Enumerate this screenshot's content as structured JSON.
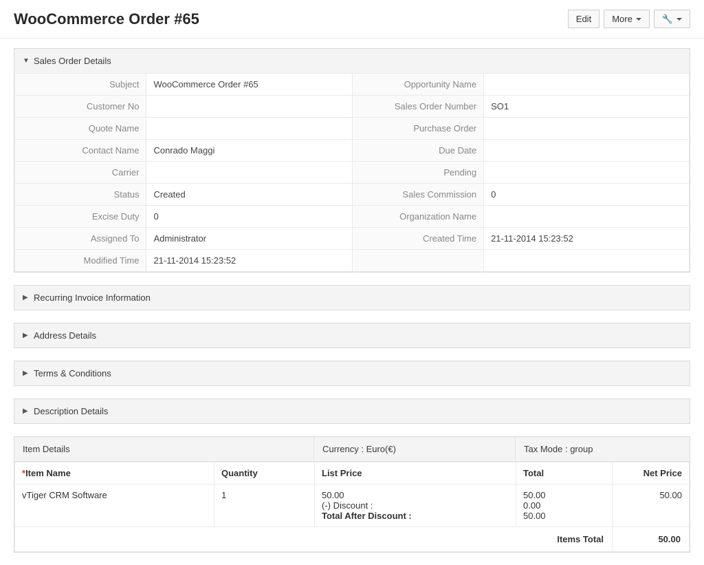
{
  "header": {
    "title": "WooCommerce Order #65",
    "buttons": {
      "edit": "Edit",
      "more": "More"
    }
  },
  "sections": {
    "sales_order_details": {
      "title": "Sales Order Details",
      "expanded": true,
      "fields": {
        "subject_label": "Subject",
        "subject_value": "WooCommerce Order #65",
        "opportunity_label": "Opportunity Name",
        "opportunity_value": "",
        "customer_no_label": "Customer No",
        "customer_no_value": "",
        "so_number_label": "Sales Order Number",
        "so_number_value": "SO1",
        "quote_name_label": "Quote Name",
        "quote_name_value": "",
        "purchase_order_label": "Purchase Order",
        "purchase_order_value": "",
        "contact_name_label": "Contact Name",
        "contact_name_value": "Conrado Maggi",
        "due_date_label": "Due Date",
        "due_date_value": "",
        "carrier_label": "Carrier",
        "carrier_value": "",
        "pending_label": "Pending",
        "pending_value": "",
        "status_label": "Status",
        "status_value": "Created",
        "sales_commission_label": "Sales Commission",
        "sales_commission_value": "0",
        "excise_duty_label": "Excise Duty",
        "excise_duty_value": "0",
        "organization_label": "Organization Name",
        "organization_value": "",
        "assigned_to_label": "Assigned To",
        "assigned_to_value": "Administrator",
        "created_time_label": "Created Time",
        "created_time_value": "21-11-2014 15:23:52",
        "modified_time_label": "Modified Time",
        "modified_time_value": "21-11-2014 15:23:52"
      }
    },
    "recurring": {
      "title": "Recurring Invoice Information",
      "expanded": false
    },
    "address": {
      "title": "Address Details",
      "expanded": false
    },
    "terms": {
      "title": "Terms & Conditions",
      "expanded": false
    },
    "description": {
      "title": "Description Details",
      "expanded": false
    }
  },
  "items": {
    "header_labels": {
      "item_details": "Item Details",
      "currency": "Currency : Euro(€)",
      "tax_mode": "Tax Mode : group"
    },
    "columns": {
      "item_name": "Item Name",
      "quantity": "Quantity",
      "list_price": "List Price",
      "total": "Total",
      "net_price": "Net Price"
    },
    "rows": [
      {
        "name": "vTiger CRM Software",
        "quantity": "1",
        "list_price": "50.00",
        "discount_label": "(-)  Discount :",
        "total_after_discount_label": "Total After Discount :",
        "total": "50.00",
        "discount_amount": "0.00",
        "total_after_discount": "50.00",
        "net_price": "50.00"
      }
    ],
    "totals": {
      "items_total_label": "Items Total",
      "items_total_value": "50.00"
    }
  }
}
